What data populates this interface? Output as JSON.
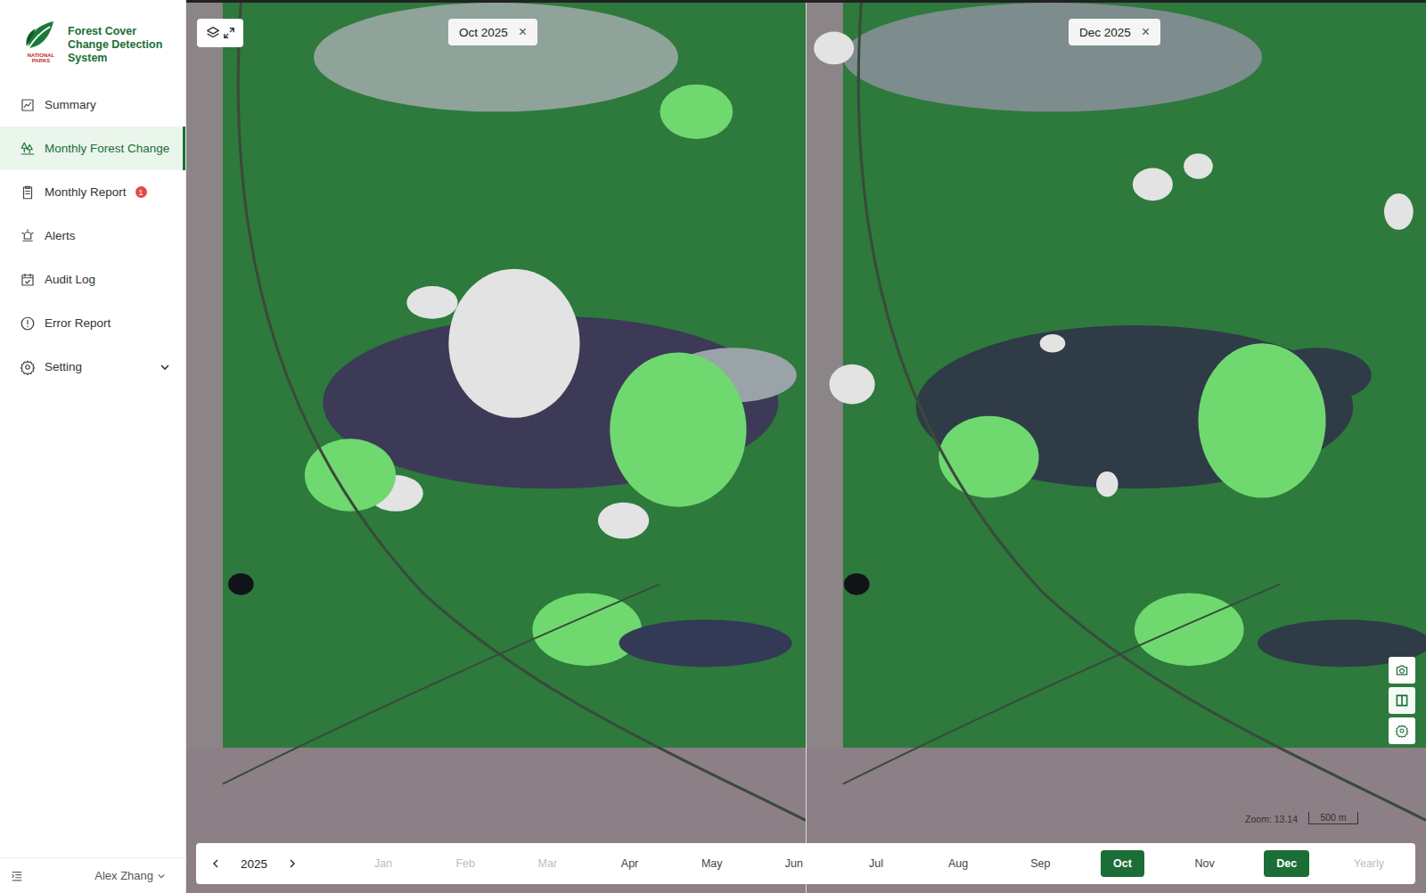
{
  "sidebar": {
    "logo_caption": "NATIONAL PARKS",
    "title": "Forest Cover Change Detection System",
    "items": [
      {
        "label": "Summary",
        "selected": false
      },
      {
        "label": "Monthly Forest Change",
        "selected": true
      },
      {
        "label": "Monthly Report",
        "selected": false,
        "badge": "1"
      },
      {
        "label": "Alerts",
        "selected": false
      },
      {
        "label": "Audit Log",
        "selected": false
      },
      {
        "label": "Error Report",
        "selected": false
      },
      {
        "label": "Setting",
        "selected": false,
        "expanded": false
      }
    ]
  },
  "user": {
    "name": "Alex Zhang"
  },
  "map": {
    "panes": [
      {
        "label": "Oct 2025",
        "close": "×"
      },
      {
        "label": "Dec 2025",
        "close": "×"
      }
    ],
    "zoom": "Zoom: 13.14",
    "scale": "500 m",
    "controls": [
      {
        "selected": false
      },
      {
        "selected": true
      },
      {
        "selected": false
      }
    ]
  },
  "timeline": {
    "year": "2025",
    "months": [
      {
        "label": "Jan",
        "disabled": true,
        "selected": false
      },
      {
        "label": "Feb",
        "disabled": true,
        "selected": false
      },
      {
        "label": "Mar",
        "disabled": true,
        "selected": false
      },
      {
        "label": "Apr",
        "disabled": false,
        "selected": false
      },
      {
        "label": "May",
        "disabled": false,
        "selected": false
      },
      {
        "label": "Jun",
        "disabled": false,
        "selected": false
      },
      {
        "label": "Jul",
        "disabled": false,
        "selected": false
      },
      {
        "label": "Aug",
        "disabled": false,
        "selected": false
      },
      {
        "label": "Sep",
        "disabled": false,
        "selected": false
      },
      {
        "label": "Oct",
        "disabled": false,
        "selected": true
      },
      {
        "label": "Nov",
        "disabled": false,
        "selected": false
      },
      {
        "label": "Dec",
        "disabled": false,
        "selected": true
      },
      {
        "label": "Yearly",
        "disabled": true,
        "selected": false
      }
    ]
  }
}
